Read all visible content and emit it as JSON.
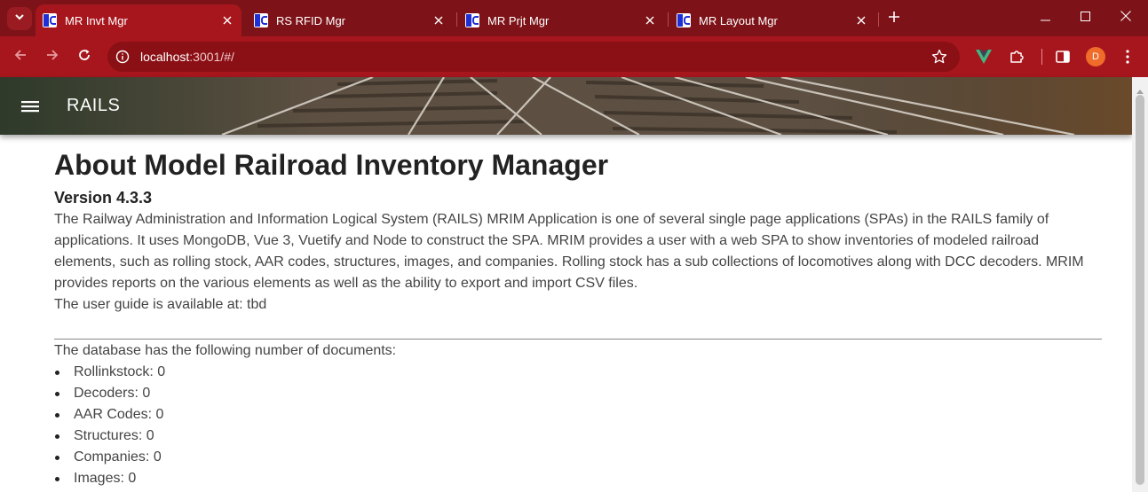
{
  "browser": {
    "tabs": [
      {
        "title": "MR Invt Mgr",
        "active": true
      },
      {
        "title": "RS RFID Mgr",
        "active": false
      },
      {
        "title": "MR Prjt Mgr",
        "active": false
      },
      {
        "title": "MR Layout Mgr",
        "active": false
      }
    ],
    "address": {
      "host": "localhost",
      "path": ":3001/#/"
    },
    "profile_initial": "D",
    "colors": {
      "frame": "#7d1318",
      "toolbar": "#a8161d",
      "omnibox": "#8a1015",
      "profile": "#f06c2a"
    }
  },
  "app": {
    "title": "RAILS"
  },
  "about": {
    "heading": "About Model Railroad Inventory Manager",
    "version": "Version 4.3.3",
    "description": "The Railway Administration and Information Logical System (RAILS) MRIM Application is one of several single page applications (SPAs) in the RAILS family of applications. It uses MongoDB, Vue 3, Vuetify and Node to construct the SPA. MRIM provides a user with a web SPA to show inventories of modeled railroad elements, such as rolling stock, AAR codes, structures, images, and companies. Rolling stock has a sub collections of locomotives along with DCC decoders. MRIM provides reports on the various elements as well as the ability to export and import CSV files.",
    "user_guide": "The user guide is available at: tbd",
    "db_intro": "The database has the following number of documents:",
    "counts": [
      "Rollinkstock: 0",
      "Decoders: 0",
      "AAR Codes: 0",
      "Structures: 0",
      "Companies: 0",
      "Images: 0"
    ]
  }
}
